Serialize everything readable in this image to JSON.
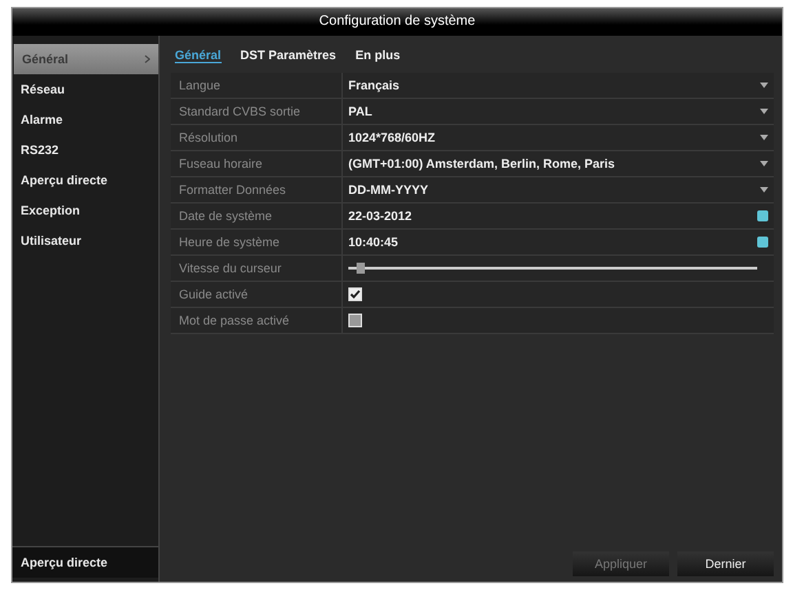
{
  "window": {
    "title": "Configuration de système"
  },
  "sidebar": {
    "items": [
      {
        "label": "Général",
        "selected": true
      },
      {
        "label": "Réseau",
        "selected": false
      },
      {
        "label": "Alarme",
        "selected": false
      },
      {
        "label": "RS232",
        "selected": false
      },
      {
        "label": "Aperçu directe",
        "selected": false
      },
      {
        "label": "Exception",
        "selected": false
      },
      {
        "label": "Utilisateur",
        "selected": false
      }
    ],
    "bottom_item": "Aperçu directe"
  },
  "tabs": [
    {
      "label": "Général",
      "selected": true
    },
    {
      "label": "DST Paramètres",
      "selected": false
    },
    {
      "label": "En plus",
      "selected": false
    }
  ],
  "settings": [
    {
      "label": "Langue",
      "kind": "select",
      "value": "Français"
    },
    {
      "label": "Standard CVBS sortie",
      "kind": "select",
      "value": "PAL"
    },
    {
      "label": "Résolution",
      "kind": "select",
      "value": "1024*768/60HZ"
    },
    {
      "label": "Fuseau horaire",
      "kind": "select",
      "value": "(GMT+01:00) Amsterdam, Berlin, Rome, Paris"
    },
    {
      "label": "Formatter Données",
      "kind": "select",
      "value": "DD-MM-YYYY"
    },
    {
      "label": "Date de système",
      "kind": "date",
      "value": "22-03-2012"
    },
    {
      "label": "Heure de système",
      "kind": "time",
      "value": "10:40:45"
    },
    {
      "label": "Vitesse du curseur",
      "kind": "slider",
      "level": 0.02
    },
    {
      "label": "Guide activé",
      "kind": "checkbox",
      "checked": true
    },
    {
      "label": "Mot de passe activé",
      "kind": "checkbox",
      "checked": false
    }
  ],
  "buttons": [
    {
      "label": "Appliquer",
      "disabled": true
    },
    {
      "label": "Dernier",
      "disabled": false
    }
  ]
}
